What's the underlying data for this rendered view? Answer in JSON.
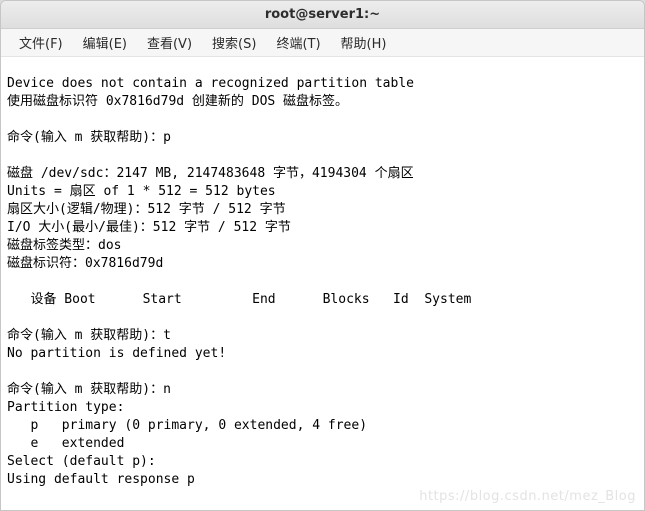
{
  "title": "root@server1:~",
  "menu": {
    "file": "文件(F)",
    "edit": "编辑(E)",
    "view": "查看(V)",
    "search": "搜索(S)",
    "terminal": "终端(T)",
    "help": "帮助(H)"
  },
  "terminal_lines": [
    "Device does not contain a recognized partition table",
    "使用磁盘标识符 0x7816d79d 创建新的 DOS 磁盘标签。",
    "",
    "命令(输入 m 获取帮助)：p",
    "",
    "磁盘 /dev/sdc：2147 MB, 2147483648 字节，4194304 个扇区",
    "Units = 扇区 of 1 * 512 = 512 bytes",
    "扇区大小(逻辑/物理)：512 字节 / 512 字节",
    "I/O 大小(最小/最佳)：512 字节 / 512 字节",
    "磁盘标签类型：dos",
    "磁盘标识符：0x7816d79d",
    "",
    "   设备 Boot      Start         End      Blocks   Id  System",
    "",
    "命令(输入 m 获取帮助)：t",
    "No partition is defined yet!",
    "",
    "命令(输入 m 获取帮助)：n",
    "Partition type:",
    "   p   primary (0 primary, 0 extended, 4 free)",
    "   e   extended",
    "Select (default p):",
    "Using default response p"
  ],
  "watermark": "https://blog.csdn.net/mez_Blog"
}
